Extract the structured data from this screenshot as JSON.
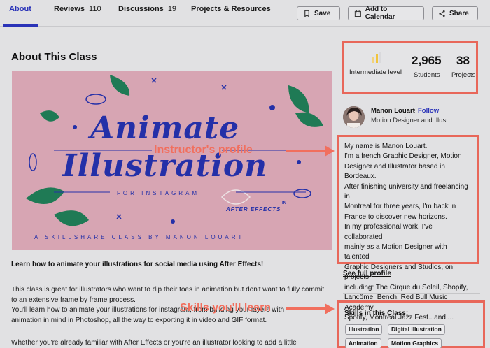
{
  "tabs": [
    {
      "label": "About",
      "count": ""
    },
    {
      "label": "Reviews",
      "count": "110"
    },
    {
      "label": "Discussions",
      "count": "19"
    },
    {
      "label": "Projects & Resources",
      "count": ""
    }
  ],
  "toolbar": {
    "save": "Save",
    "calendar": "Add to Calendar",
    "share": "Share"
  },
  "main": {
    "title": "About This Class",
    "banner": {
      "line1": "Animate",
      "line2": "Illustration",
      "for": "FOR INSTAGRAM",
      "in": "IN",
      "ae": "AFTER EFFECTS",
      "sub": "A SKILLSHARE CLASS BY MANON LOUART"
    },
    "lead": "Learn how to animate your illustrations for social media using After Effects!",
    "p1": [
      "This class is great for illustrators who want to dip their toes in animation but don't want to fully commit",
      "to an extensive frame by frame process.",
      "You'll learn how to animate your illustrations for instagram, from building your layers with",
      "animation in mind in Photoshop, all the way to exporting it in video and GIF format."
    ],
    "p2": "Whether you're already familiar with After Effects or you're an illustrator looking to add a little"
  },
  "stats": {
    "level": "Intermediate level",
    "students_value": "2,965",
    "students_label": "Students",
    "projects_value": "38",
    "projects_label": "Projects"
  },
  "instructor": {
    "name": "Manon Louart",
    "dot": "•",
    "follow": "Follow",
    "role": "Motion Designer and Illust...",
    "bio": [
      "My name is Manon Louart.",
      "I'm a french Graphic Designer, Motion",
      "Designer and Illustrator based in Bordeaux.",
      "After finishing university and freelancing in",
      "Montreal for three years, I'm back in",
      "France to discover new horizons.",
      "In my professional work, I've collaborated",
      "mainly as a Motion Designer with talented",
      "Graphic Designers and Studios, on projects",
      "including: The Cirque du Soleil, Shopify,",
      "Lancôme, Bench, Red Bull Music Academy,",
      "Spotify, Montreal Jazz Fest...and ..."
    ],
    "see_full": "See full profile"
  },
  "skills": {
    "title": "Skills in this Class:",
    "items": [
      "Illustration",
      "Digital Illustration",
      "Animation",
      "Motion Graphics"
    ]
  },
  "annotations": {
    "instructor": "Instructor's profile",
    "skills": "Skills you'll learn"
  },
  "colors": {
    "accent": "#2a33b8",
    "highlight": "#e8675a",
    "annotation": "#f16f5e"
  }
}
